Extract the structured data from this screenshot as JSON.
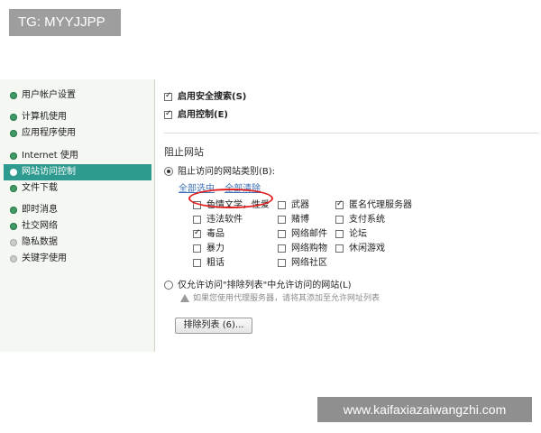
{
  "watermark_top": "TG: MYYJJPP",
  "watermark_bottom": "www.kaifaxiazaiwangzhi.com",
  "sidebar": {
    "items": [
      {
        "label": "用户帐户设置",
        "dot": "green"
      },
      {
        "label": "计算机使用",
        "dot": "green"
      },
      {
        "label": "应用程序使用",
        "dot": "green"
      },
      {
        "label": "Internet 使用",
        "dot": "green"
      },
      {
        "label": "网站访问控制",
        "dot": "white",
        "active": true
      },
      {
        "label": "文件下载",
        "dot": "green"
      },
      {
        "label": "即时消息",
        "dot": "green"
      },
      {
        "label": "社交网络",
        "dot": "green"
      },
      {
        "label": "隐私数据",
        "dot": "grey"
      },
      {
        "label": "关键字使用",
        "dot": "grey"
      }
    ]
  },
  "options": {
    "safe_search": {
      "label": "启用安全搜索(S)",
      "checked": true
    },
    "control": {
      "label": "启用控制(E)",
      "checked": true
    }
  },
  "section_title": "阻止网站",
  "block_mode": {
    "label": "阻止访问的网站类别(B):",
    "selected": true
  },
  "links": {
    "select_all": "全部选中",
    "clear_all": "全部清除"
  },
  "categories": [
    {
      "label": "色情文学，性爱",
      "checked": false
    },
    {
      "label": "违法软件",
      "checked": false
    },
    {
      "label": "毒品",
      "checked": true
    },
    {
      "label": "暴力",
      "checked": false
    },
    {
      "label": "粗话",
      "checked": false
    },
    {
      "label": "武器",
      "checked": false
    },
    {
      "label": "赌博",
      "checked": false
    },
    {
      "label": "网络邮件",
      "checked": false
    },
    {
      "label": "网络购物",
      "checked": false
    },
    {
      "label": "网络社区",
      "checked": false
    },
    {
      "label": "匿名代理服务器",
      "checked": true
    },
    {
      "label": "支付系统",
      "checked": false
    },
    {
      "label": "论坛",
      "checked": false
    },
    {
      "label": "休闲游戏",
      "checked": false
    }
  ],
  "allow_mode": {
    "label": "仅允许访问\"排除列表\"中允许访问的网站(L)",
    "selected": false
  },
  "hint": "如果您使用代理服务器，请将其添加至允许网址列表",
  "exclude_button": "排除列表 (6)..."
}
